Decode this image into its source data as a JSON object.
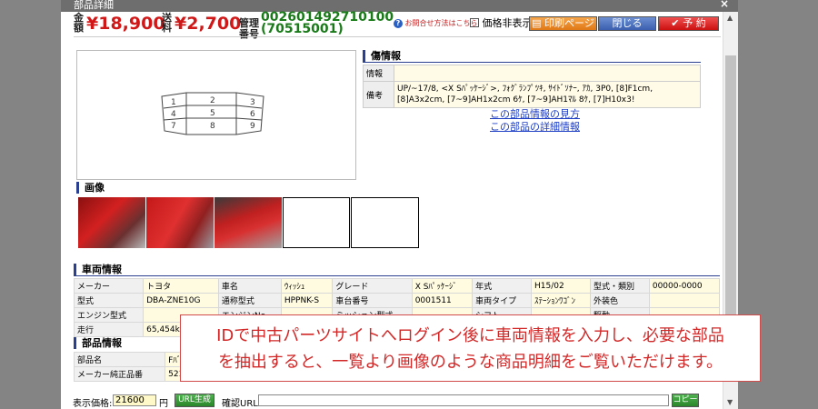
{
  "title": "部品詳細",
  "close_glyph": "×",
  "price": {
    "label_kin": "金",
    "label_gaku": "額",
    "amount": "¥18,900",
    "shipping_label_top": "送",
    "shipping_label_bottom": "料",
    "shipping": "¥2,700",
    "mgmt_label_top": "管理",
    "mgmt_label_bottom": "番号",
    "mgmt_number": "002601492710100",
    "mgmt_sub": "(70515001)"
  },
  "toolbar": {
    "inquiry_label": "お問合せ方法はこちら",
    "hide_price_label": "価格非表示",
    "print_label": "印刷ページ",
    "close_label": "閉じる",
    "reserve_label": "予 約"
  },
  "damage": {
    "heading": "傷情報",
    "row1_label": "情報",
    "row1_value": "",
    "row2_label": "備考",
    "row2_value": "UP/~17/8, <X Sﾊﾟｯｹｰｼﾞ>, ﾌｫｸﾞﾗﾝﾌﾟﾂｷ, ｻｲﾄﾞｿﾅｰ, ｱｶ, 3P0, [8]F1cm, [8]A3x2cm, [7~9]AH1x2cm 6ｹ, [7~9]AH1ﾏﾙ 8ｹ, [7]H10x3!",
    "link1": "この部品情報の見方",
    "link2": "この部品の詳細情報"
  },
  "diagram_numbers": [
    "1",
    "2",
    "3",
    "4",
    "5",
    "6",
    "7",
    "8",
    "9"
  ],
  "images": {
    "heading": "画像"
  },
  "vehicle": {
    "heading": "車両情報",
    "rows": [
      [
        "メーカー",
        "トヨタ",
        "車名",
        "ｳｨｯｼｭ",
        "グレード",
        "X Sﾊﾟｯｹｰｼﾞ",
        "年式",
        "H15/02",
        "型式・類別",
        "00000-0000"
      ],
      [
        "型式",
        "DBA-ZNE10G",
        "通称型式",
        "HPPNK-S",
        "車台番号",
        "0001511",
        "車両タイプ",
        "ｽﾃｰｼｮﾝﾜｺﾞﾝ",
        "外装色",
        ""
      ],
      [
        "エンジン型式",
        "",
        "エンジンNo",
        "",
        "ミッション型式",
        "",
        "シフト",
        "",
        "駆動",
        ""
      ],
      [
        "走行",
        "65,454km",
        "",
        "",
        "",
        "",
        "",
        "",
        "",
        ""
      ]
    ]
  },
  "parts": {
    "heading": "部品情報",
    "rows": [
      [
        "部品名",
        "FﾊﾞﾝﾊﾟｰASSY"
      ],
      [
        "メーカー純正品番",
        "52119-6"
      ]
    ]
  },
  "overlay": {
    "line1": "IDで中古パーツサイトへログイン後に車両情報を入力し、必要な部品",
    "line2": "を抽出すると、一覧より画像のような商品明細をご覧いただけます。"
  },
  "bottom": {
    "price_label": "表示価格:",
    "price_value": "21600",
    "yen": "円",
    "url_button": "URL生成",
    "confirm_label": "確認URL:",
    "copy_button": "コピー"
  }
}
